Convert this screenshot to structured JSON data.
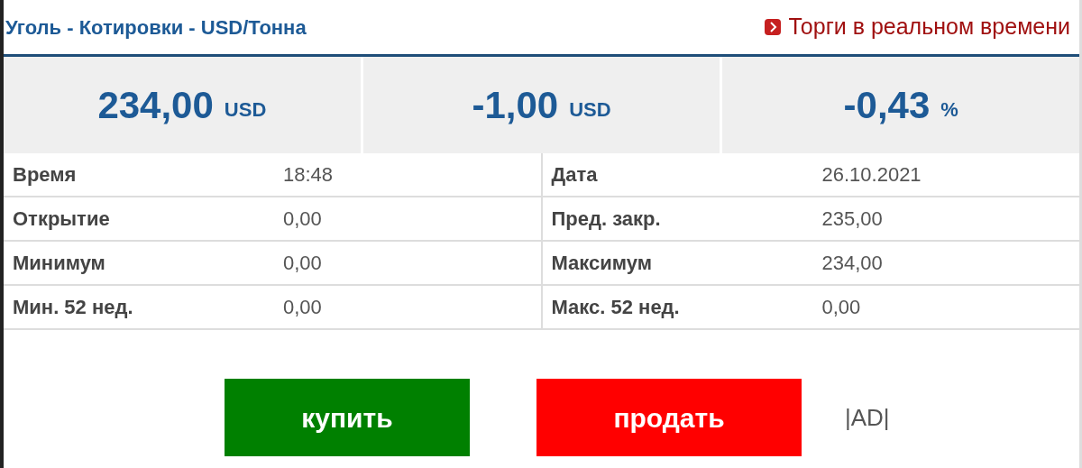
{
  "title": "Уголь - Котировки - USD/Тонна",
  "live_link": "Торги в реальном времени",
  "quotes": [
    {
      "value": "234,00",
      "unit": "USD"
    },
    {
      "value": "-1,00",
      "unit": "USD"
    },
    {
      "value": "-0,43",
      "unit": "%"
    }
  ],
  "stats": [
    {
      "label": "Время",
      "value": "18:48",
      "label2": "Дата",
      "value2": "26.10.2021"
    },
    {
      "label": "Открытие",
      "value": "0,00",
      "label2": "Пред. закр.",
      "value2": "235,00"
    },
    {
      "label": "Минимум",
      "value": "0,00",
      "label2": "Максимум",
      "value2": "234,00"
    },
    {
      "label": "Мин. 52 нед.",
      "value": "0,00",
      "label2": "Макс. 52 нед.",
      "value2": "0,00"
    }
  ],
  "buttons": [
    {
      "label": "купить",
      "kind": "buy"
    },
    {
      "label": "продать",
      "kind": "sell"
    }
  ],
  "ad": "|AD|"
}
